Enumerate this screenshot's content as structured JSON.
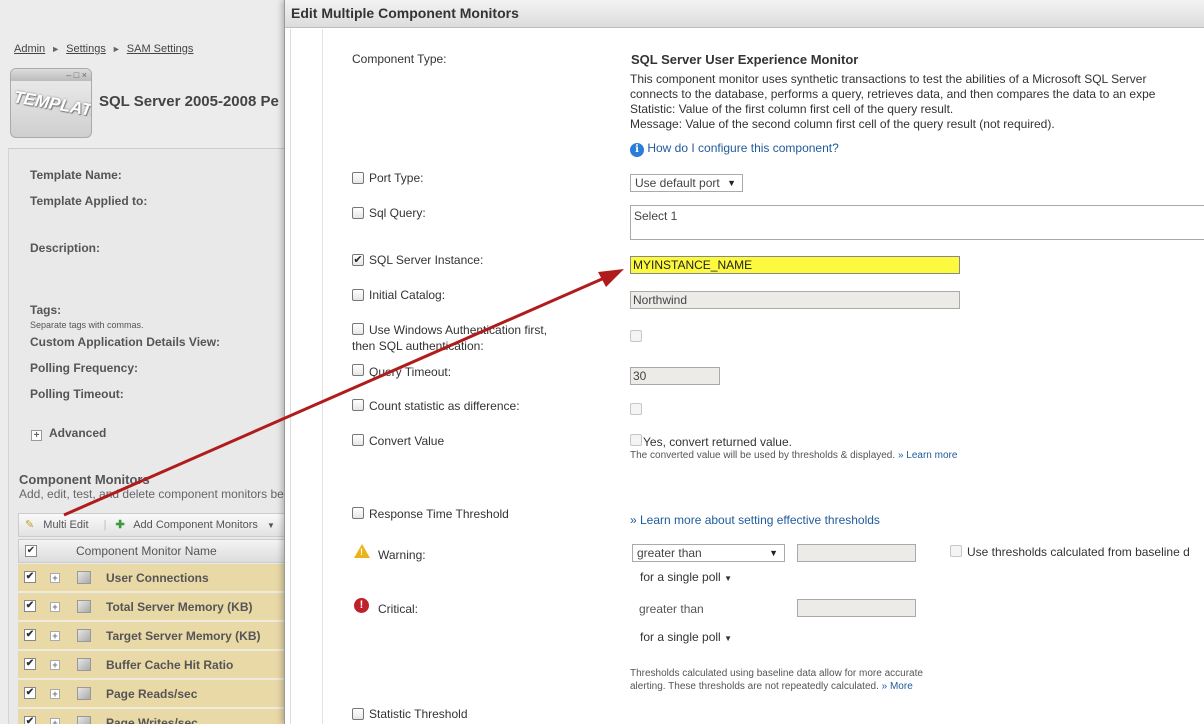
{
  "breadcrumb": [
    "Admin",
    "Settings",
    "SAM Settings"
  ],
  "template": {
    "icon_text": "TEMPLATE",
    "title": "SQL Server 2005-2008 Pe",
    "fields": {
      "name": "Template Name:",
      "applied_to": "Template Applied to:",
      "description": "Description:",
      "tags": "Tags:",
      "tags_note": "Separate tags with commas.",
      "custom_view": "Custom Application Details View:",
      "polling_frequency": "Polling Frequency:",
      "polling_timeout": "Polling Timeout:"
    },
    "advanced": "Advanced"
  },
  "component_monitors": {
    "heading": "Component Monitors",
    "description": "Add, edit, test, and delete component monitors be",
    "toolbar": {
      "multi_edit": "Multi Edit",
      "add": "Add Component Monitors"
    },
    "column_header": "Component Monitor Name",
    "rows": [
      "User Connections",
      "Total Server Memory (KB)",
      "Target Server Memory (KB)",
      "Buffer Cache Hit Ratio",
      "Page Reads/sec",
      "Page Writes/sec"
    ]
  },
  "dialog": {
    "title": "Edit Multiple Component Monitors",
    "component_type_label": "Component Type:",
    "component_type": "SQL Server User Experience Monitor",
    "desc_lines": [
      "This component monitor uses synthetic transactions to test the abilities of a Microsoft SQL Server",
      "connects to the database, performs a query, retrieves data, and then compares the data to an expe",
      "Statistic: Value of the first column first cell of the query result.",
      "Message: Value of the second column first cell of the query result (not required)."
    ],
    "help_link": "How do I configure this component?",
    "port_type": {
      "label": "Port Type:",
      "value": "Use default port"
    },
    "sql_query": {
      "label": "Sql Query:",
      "value": "Select 1"
    },
    "sql_instance": {
      "label": "SQL Server Instance:",
      "value": "MYINSTANCE_NAME",
      "checked": true
    },
    "initial_catalog": {
      "label": "Initial Catalog:",
      "value": "Northwind"
    },
    "windows_auth": {
      "label_line1": "Use Windows Authentication first,",
      "label_line2": "then SQL authentication:"
    },
    "query_timeout": {
      "label": "Query Timeout:",
      "value": "30"
    },
    "count_statistic": {
      "label": "Count statistic as difference:"
    },
    "convert_value": {
      "label": "Convert Value",
      "option": "Yes, convert returned value.",
      "note": "The converted value will be used by thresholds & displayed.",
      "learn_more": "» Learn more"
    },
    "response_threshold": {
      "label": "Response Time Threshold",
      "learn_link": "» Learn more about setting effective thresholds"
    },
    "warning": {
      "label": "Warning:",
      "operator": "greater than",
      "poll": "for a single poll"
    },
    "critical": {
      "label": "Critical:",
      "operator": "greater than",
      "poll": "for a single poll"
    },
    "baseline": "Use thresholds calculated from baseline d",
    "baseline_note_line1": "Thresholds calculated using baseline data allow for more accurate",
    "baseline_note_line2": "alerting. These thresholds are not repeatedly calculated.",
    "baseline_more": "» More",
    "statistic_threshold": {
      "label": "Statistic Threshold"
    }
  },
  "colors": {
    "highlight": "#fcf93e",
    "link": "#1f5a9c",
    "arrow": "#b01c1c",
    "row_bg": "#e9d9a7"
  }
}
